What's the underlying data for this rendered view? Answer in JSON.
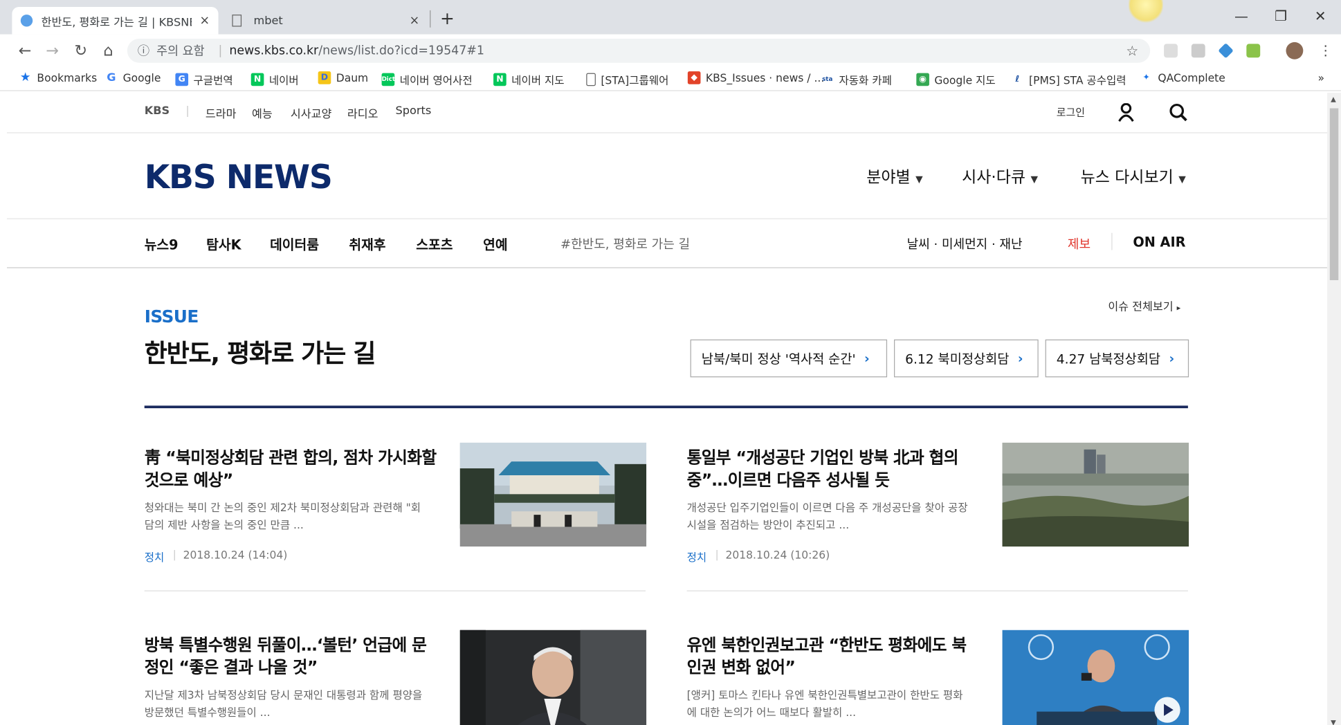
{
  "browser": {
    "tabs": [
      {
        "title": "한반도, 평화로 가는 길 | KBSNE",
        "close": "×"
      },
      {
        "title": "mbet",
        "close": "×"
      }
    ],
    "new_tab": "+",
    "window_controls": {
      "minimize": "—",
      "restore": "❐",
      "close": "✕"
    },
    "address": {
      "security_label": "주의 요함",
      "host": "news.kbs.co.kr",
      "path": "/news/list.do?icd=19547#1"
    },
    "bookmarks": [
      "Bookmarks",
      "Google",
      "구글번역",
      "네이버",
      "Daum",
      "네이버 영어사전",
      "네이버 지도",
      "[STA]그룹웨어",
      "KBS_Issues · news / ...",
      "자동화 카페",
      "Google 지도",
      "[PMS] STA 공수입력",
      "QAComplete"
    ],
    "bookmarks_more": "»"
  },
  "gnb": {
    "brand": "KBS",
    "items": [
      "드라마",
      "예능",
      "시사교양",
      "라디오",
      "Sports"
    ],
    "login": "로그인"
  },
  "header": {
    "logo": "KBS NEWS",
    "menus": [
      "분야별",
      "시사·다큐",
      "뉴스 다시보기"
    ]
  },
  "subnav": {
    "items": [
      "뉴스9",
      "탐사K",
      "데이터룸",
      "취재후",
      "스포츠",
      "연예"
    ],
    "hashtag": "#한반도, 평화로 가는 길",
    "weather": "날씨 · 미세먼지 · 재난",
    "report": "제보",
    "onair": "ON AIR"
  },
  "issue": {
    "label": "ISSUE",
    "title": "한반도, 평화로 가는 길",
    "view_all": "이슈 전체보기",
    "buttons": [
      "남북/북미 정상 '역사적 순간'",
      "6.12 북미정상회담",
      "4.27 남북정상회담"
    ]
  },
  "articles": [
    {
      "title": "靑 “북미정상회담 관련 합의, 점차 가시화할 것으로 예상”",
      "desc": "청와대는 북미 간 논의 중인 제2차 북미정상회담과 관련해 \"회담의 제반 사항을 논의 중인 만큼 ...",
      "category": "정치",
      "date": "2018.10.24 (14:04)"
    },
    {
      "title": "통일부 “개성공단 기업인 방북 北과 협의 중”…이르면 다음주 성사될 듯",
      "desc": "개성공단 입주기업인들이 이르면 다음 주 개성공단을 찾아 공장 시설을 점검하는 방안이 추진되고 ...",
      "category": "정치",
      "date": "2018.10.24 (10:26)"
    },
    {
      "title": "방북 특별수행원 뒤풀이…‘볼턴’ 언급에 문정인 “좋은 결과 나올 것”",
      "desc": "지난달 제3차 남북정상회담 당시 문재인 대통령과 함께 평양을 방문했던 특별수행원들이 ...",
      "category": "",
      "date": ""
    },
    {
      "title": "유엔 북한인권보고관 “한반도 평화에도 북 인권 변화 없어”",
      "desc": "[앵커] 토마스 킨타나 유엔 북한인권특별보고관이 한반도 평화에 대한 논의가 어느 때보다 활발히 ...",
      "category": "",
      "date": ""
    }
  ]
}
